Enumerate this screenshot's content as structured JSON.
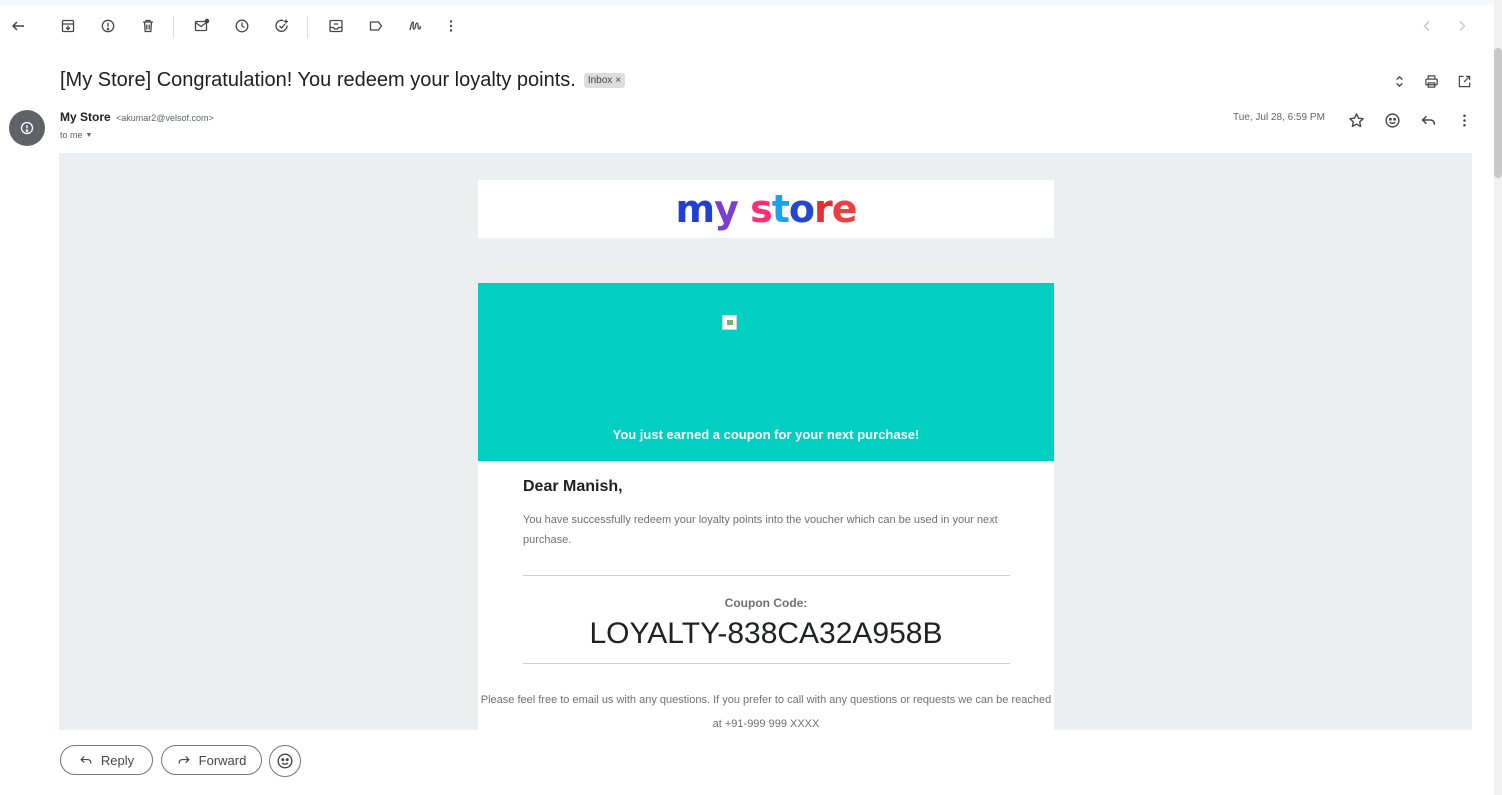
{
  "toolbar": {
    "icons": [
      "back-arrow-icon",
      "archive-icon",
      "report-spam-icon",
      "delete-icon",
      "mark-unread-icon",
      "snooze-icon",
      "add-task-icon",
      "move-to-icon",
      "label-icon",
      "more-actions-icon"
    ],
    "nav": [
      "newer-chevron-icon",
      "older-chevron-icon"
    ]
  },
  "email": {
    "subject": "[My Store] Congratulation! You redeem your loyalty points.",
    "label": "Inbox",
    "label_remove": "×",
    "sender_name": "My Store",
    "sender_email": "<akumar2@velsof.com>",
    "recipient": "to me",
    "date": "Tue, Jul 28, 6:59 PM"
  },
  "body": {
    "logo_letters": [
      {
        "char": "m",
        "color": "#1f3fd6"
      },
      {
        "char": "y",
        "color": "#7a3fd1"
      },
      {
        "char": " ",
        "color": "#ffffff"
      },
      {
        "char": "s",
        "color": "#ff2d73"
      },
      {
        "char": "t",
        "color": "#1ba3e8"
      },
      {
        "char": "o",
        "color": "#2547d0"
      },
      {
        "char": "r",
        "color": "#e52f2f"
      },
      {
        "char": "e",
        "color": "#f13d3d"
      }
    ],
    "hero_text": "You just earned a coupon for your next purchase!",
    "greeting": "Dear Manish,",
    "message": "You have successfully redeem your loyalty points into the voucher which can be used in your next purchase.",
    "coupon_label": "Coupon Code:",
    "coupon_code": "LOYALTY-838CA32A958B",
    "footer": "Please feel free to email us with any questions. If you prefer to call with any questions or requests we can be reached at +91-999 999 XXXX"
  },
  "actions": {
    "reply": "Reply",
    "forward": "Forward"
  },
  "colors": {
    "hero": "#00cfc1",
    "body_bg": "#ebefef",
    "avatar": "#5f6368"
  }
}
